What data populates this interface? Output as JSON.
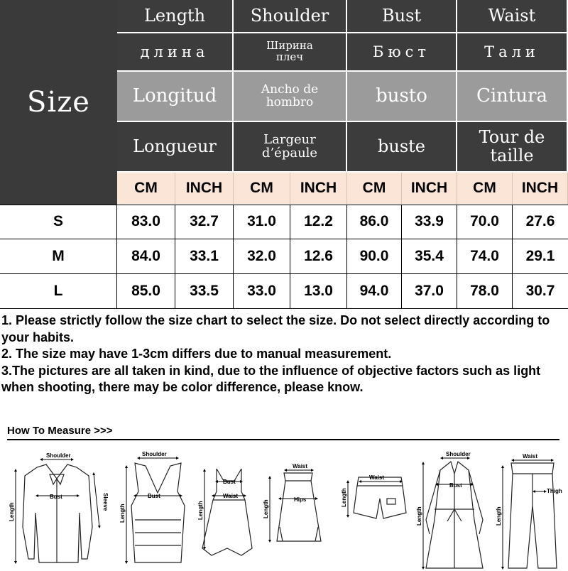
{
  "table": {
    "size_label": "Size",
    "columns": [
      {
        "header": [
          "Length",
          "длина",
          "Longitud",
          "Longueur"
        ]
      },
      {
        "header": [
          "Shoulder",
          "Ширина\nплеч",
          "Ancho de\nhombro",
          "Largeur\nd’épaule"
        ]
      },
      {
        "header": [
          "Bust",
          "Бюст",
          "busto",
          "buste"
        ]
      },
      {
        "header": [
          "Waist",
          "Тали",
          "Cintura",
          "Tour de\ntaille"
        ]
      }
    ],
    "units": [
      "CM",
      "INCH",
      "CM",
      "INCH",
      "CM",
      "INCH",
      "CM",
      "INCH"
    ],
    "rows": [
      {
        "size": "S",
        "values": [
          "83.0",
          "32.7",
          "31.0",
          "12.2",
          "86.0",
          "33.9",
          "70.0",
          "27.6"
        ]
      },
      {
        "size": "M",
        "values": [
          "84.0",
          "33.1",
          "32.0",
          "12.6",
          "90.0",
          "35.4",
          "74.0",
          "29.1"
        ]
      },
      {
        "size": "L",
        "values": [
          "85.0",
          "33.5",
          "33.0",
          "13.0",
          "94.0",
          "37.0",
          "78.0",
          "30.7"
        ]
      }
    ]
  },
  "notes": [
    "1. Please strictly follow the size chart to select the size. Do not select directly according to your habits.",
    "2. The size may have 1-3cm differs due to manual measurement.",
    "3.The pictures are all taken in kind, due to the influence of objective factors such as light when shooting, there may be color difference, please know."
  ],
  "how_to_measure": {
    "title": "How To Measure",
    "arrows": ">>>",
    "labels": {
      "shoulder": "Shoulder",
      "bust": "Bust",
      "sleeve": "Sleeve",
      "length": "Length",
      "waist": "Waist",
      "hips": "Hips",
      "thigh": "Thigh"
    }
  }
}
